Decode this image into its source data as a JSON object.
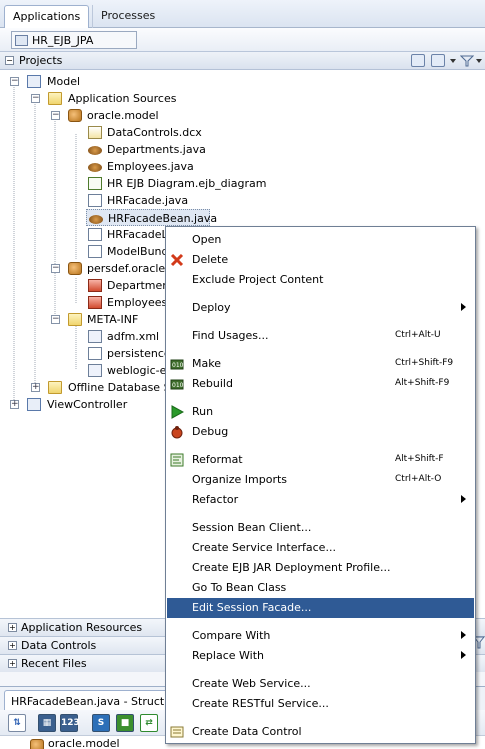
{
  "tabs": {
    "applications": "Applications",
    "processes": "Processes"
  },
  "app": {
    "name": "HR_EJB_JPA"
  },
  "projects_panel": {
    "title": "Projects"
  },
  "tree": {
    "model": "Model",
    "application_sources": "Application Sources",
    "oracle_model": "oracle.model",
    "datacontrols": "DataControls.dcx",
    "departments": "Departments.java",
    "employees": "Employees.java",
    "hr_ejb_diagram": "HR EJB Diagram.ejb_diagram",
    "hrfacade": "HRFacade.java",
    "hrfacadebean": "HRFacadeBean.java",
    "hrfacadelocal": "HRFacadeLo",
    "modelbundle": "ModelBundle",
    "persdef": "persdef.oracle.m",
    "persdef_departments": "Department",
    "persdef_employees": "Employees.:",
    "meta_inf": "META-INF",
    "adfm": "adfm.xml",
    "persistence": "persistence",
    "weblogic": "weblogic-ejb",
    "offline_db": "Offline Database So",
    "viewcontroller": "ViewController"
  },
  "accordions": {
    "app_resources": "Application Resources",
    "data_controls": "Data Controls",
    "recent_files": "Recent Files"
  },
  "structure": {
    "tab_title": "HRFacadeBean.java - Structure",
    "root_item": "oracle.model"
  },
  "menu": {
    "open": "Open",
    "delete": "Delete",
    "exclude": "Exclude Project Content",
    "deploy": "Deploy",
    "find_usages": "Find Usages...",
    "find_usages_sc": "Ctrl+Alt-U",
    "make": "Make",
    "make_sc": "Ctrl+Shift-F9",
    "rebuild": "Rebuild",
    "rebuild_sc": "Alt+Shift-F9",
    "run": "Run",
    "debug": "Debug",
    "reformat": "Reformat",
    "reformat_sc": "Alt+Shift-F",
    "organize_imports": "Organize Imports",
    "organize_imports_sc": "Ctrl+Alt-O",
    "refactor": "Refactor",
    "session_bean_client": "Session Bean Client...",
    "create_service_interface": "Create Service Interface...",
    "create_ejb_jar": "Create EJB JAR Deployment Profile...",
    "go_to_bean_class": "Go To Bean Class",
    "edit_session_facade": "Edit Session Facade...",
    "compare_with": "Compare With",
    "replace_with": "Replace With",
    "create_web_service": "Create Web Service...",
    "create_restful_service": "Create RESTful Service...",
    "create_data_control": "Create Data Control"
  },
  "colors": {
    "highlight": "#2f5a95",
    "tab_bar": "#dbe4f1",
    "run_green": "#2a9a2a",
    "delete_red": "#d23a1a"
  }
}
